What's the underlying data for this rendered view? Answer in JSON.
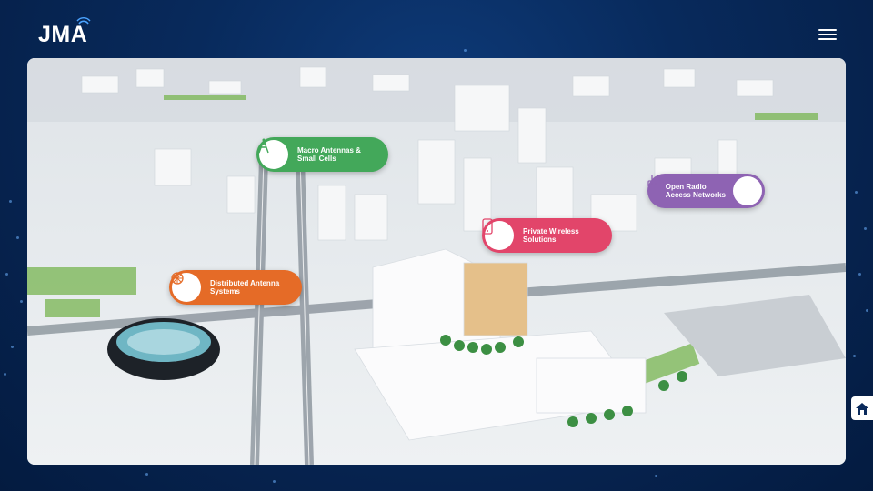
{
  "brand": {
    "logo_text": "JMA",
    "logo_icon": "signal-waves-icon"
  },
  "header": {
    "menu_icon": "hamburger-menu-icon"
  },
  "hotspots": [
    {
      "id": "macro",
      "label": "Macro Antennas &\nSmall Cells",
      "icon": "cell-tower-icon",
      "color": "#43a85a"
    },
    {
      "id": "das",
      "label": "Distributed Antenna\nSystems",
      "icon": "antenna-network-icon",
      "color": "#e56b27"
    },
    {
      "id": "private",
      "label": "Private Wireless\nSolutions",
      "icon": "smartphone-icon",
      "color": "#e2456a"
    },
    {
      "id": "oran",
      "label": "Open Radio\nAccess Networks",
      "icon": "router-icon",
      "color": "#8e63b3"
    }
  ],
  "home_button": {
    "icon": "home-icon"
  }
}
